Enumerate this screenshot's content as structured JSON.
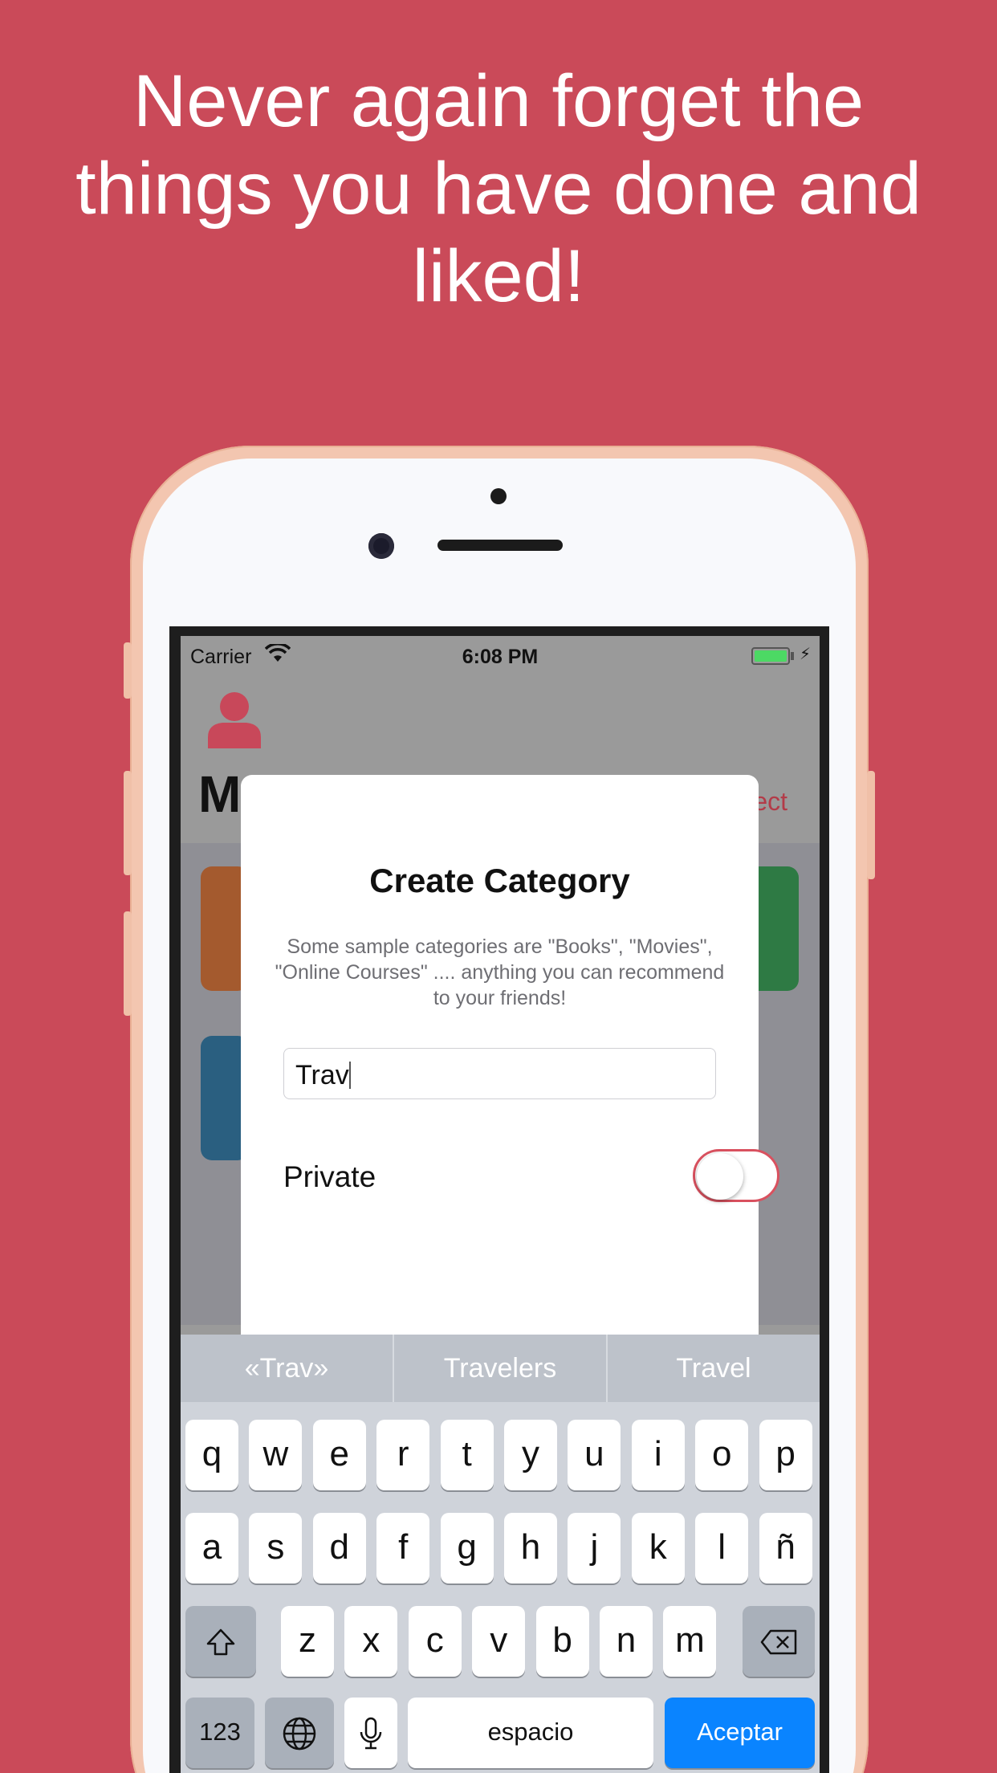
{
  "headline": "Never again forget the things you have done and liked!",
  "status_bar": {
    "carrier": "Carrier",
    "time": "6:08 PM"
  },
  "background_screen": {
    "title_fragment": "M",
    "select_fragment": "ect"
  },
  "modal": {
    "title": "Create Category",
    "description": "Some sample categories are \"Books\", \"Movies\", \"Online Courses\" .... anything you can recommend to your friends!",
    "input_value": "Trav",
    "private_label": "Private",
    "private_on": false
  },
  "keyboard": {
    "suggestions": [
      "«Trav»",
      "Travelers",
      "Travel"
    ],
    "row1": [
      "q",
      "w",
      "e",
      "r",
      "t",
      "y",
      "u",
      "i",
      "o",
      "p"
    ],
    "row2": [
      "a",
      "s",
      "d",
      "f",
      "g",
      "h",
      "j",
      "k",
      "l",
      "ñ"
    ],
    "row3": [
      "z",
      "x",
      "c",
      "v",
      "b",
      "n",
      "m"
    ],
    "numbers_label": "123",
    "space_label": "espacio",
    "return_label": "Aceptar"
  },
  "colors": {
    "background": "#ca4a59",
    "accent": "#d9515f",
    "return_key": "#0a84ff"
  }
}
